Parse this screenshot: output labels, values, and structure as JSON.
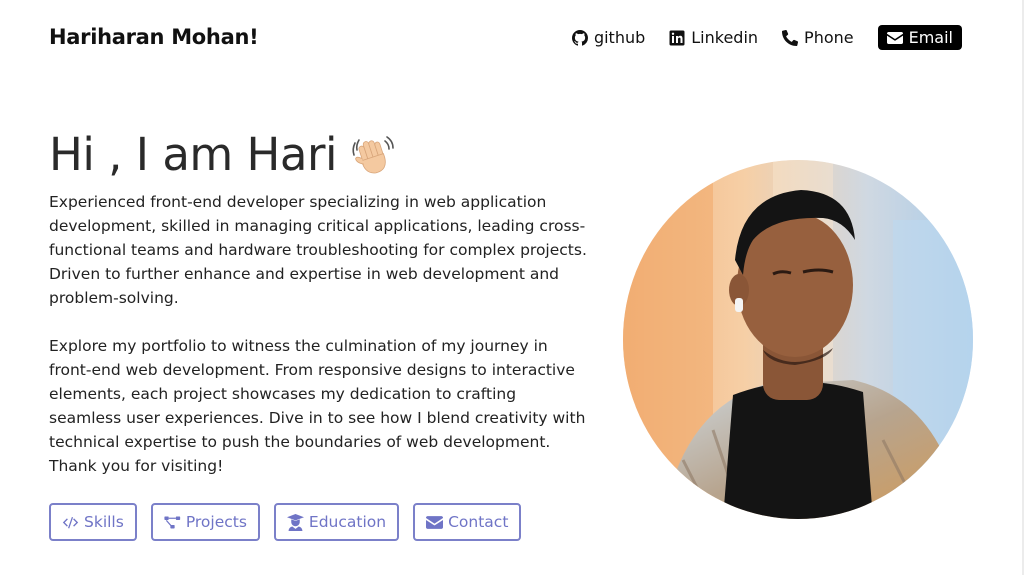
{
  "nav": {
    "brand": "Hariharan Mohan!",
    "links": [
      {
        "label": "github",
        "icon": "github-icon"
      },
      {
        "label": "Linkedin",
        "icon": "linkedin-icon"
      },
      {
        "label": "Phone",
        "icon": "phone-icon"
      },
      {
        "label": "Email",
        "icon": "envelope-icon"
      }
    ]
  },
  "hero": {
    "title": "Hi , I am Hari",
    "emoji_icon": "waving-hand-icon",
    "paragraph1": "Experienced front-end developer specializing in web application development, skilled in managing critical applications, leading cross-functional teams and hardware troubleshooting for complex projects. Driven to further enhance and expertise in web development and problem-solving.",
    "paragraph2": "Explore my portfolio to witness the culmination of my journey in front-end web development. From responsive designs to interactive elements, each project showcases my dedication to crafting seamless user experiences. Dive in to see how I blend creativity with technical expertise to push the boundaries of web development. Thank you for visiting!"
  },
  "buttons": [
    {
      "label": "Skills",
      "icon": "code-icon"
    },
    {
      "label": "Projects",
      "icon": "project-diagram-icon"
    },
    {
      "label": "Education",
      "icon": "graduate-icon"
    },
    {
      "label": "Contact",
      "icon": "envelope-icon"
    }
  ],
  "colors": {
    "accent": "#6f74c6",
    "email_button_bg": "#000000"
  }
}
